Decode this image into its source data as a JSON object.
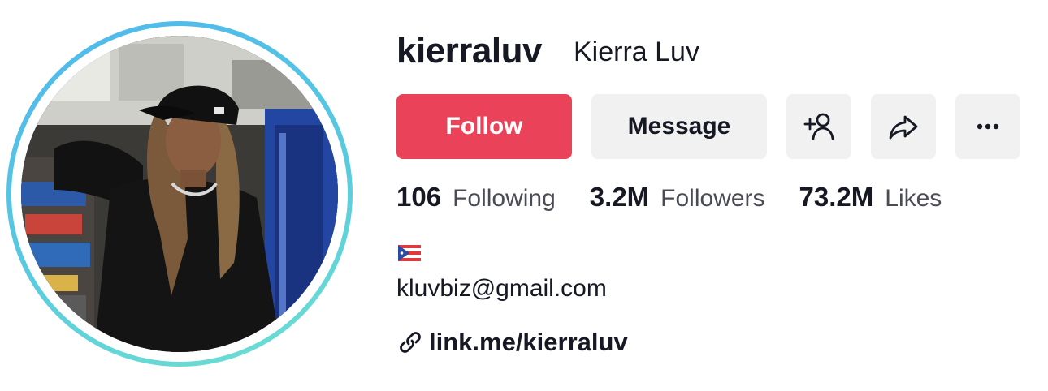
{
  "profile": {
    "username": "kierraluv",
    "display_name": "Kierra Luv",
    "avatar_icon": "profile-photo"
  },
  "actions": {
    "follow_label": "Follow",
    "message_label": "Message",
    "add_friend_icon": "add-person-icon",
    "share_icon": "share-arrow-icon",
    "more_icon": "more-dots-icon"
  },
  "stats": [
    {
      "value": "106",
      "label": "Following"
    },
    {
      "value": "3.2M",
      "label": "Followers"
    },
    {
      "value": "73.2M",
      "label": "Likes"
    }
  ],
  "bio": {
    "flag_icon": "puerto-rico-flag-icon",
    "email": "kluvbiz@gmail.com",
    "link_icon": "link-icon",
    "link_text": "link.me/kierraluv"
  },
  "colors": {
    "follow_bg": "#ea4359",
    "button_bg": "#f1f1f2",
    "text_primary": "#161823",
    "text_secondary": "#4a4b55",
    "ring_gradient_start": "#4fb7ec",
    "ring_gradient_end": "#6ee0d0"
  }
}
